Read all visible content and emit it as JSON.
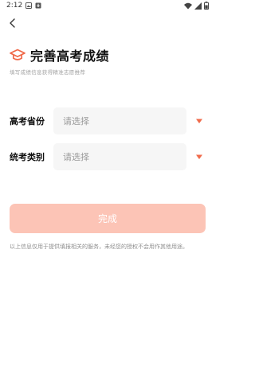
{
  "status_bar": {
    "time": "2:12",
    "icons": [
      "image-icon",
      "download-icon",
      "wifi-icon",
      "signal-icon",
      "battery-icon"
    ]
  },
  "header": {
    "back_icon": "chevron-left-icon",
    "title_icon": "graduation-cap-icon",
    "title": "完善高考成绩",
    "subtitle": "填写成绩信息获得精准志愿推荐"
  },
  "form": {
    "fields": [
      {
        "label": "高考省份",
        "placeholder": "请选择"
      },
      {
        "label": "统考类别",
        "placeholder": "请选择"
      }
    ]
  },
  "submit": {
    "label": "完成"
  },
  "disclaimer": "以上信息仅用于提供填报相关的服务，未经您的授权不会用作其他用途。",
  "colors": {
    "accent": "#f06a4a",
    "button_disabled": "#fcc4b6",
    "field_bg": "#f6f6f6",
    "hint_text": "#a3a3a3"
  }
}
